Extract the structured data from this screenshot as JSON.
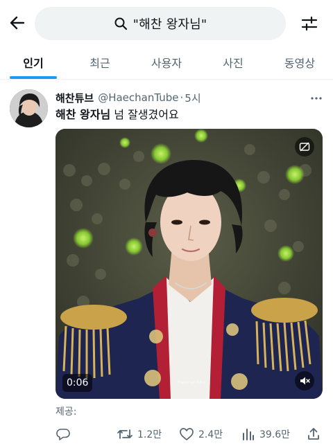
{
  "header": {
    "back_icon": "arrow-left-icon",
    "search_query": "\"해찬 왕자님\"",
    "search_icon": "search-icon",
    "filter_icon": "sliders-icon"
  },
  "tabs": [
    {
      "label": "인기",
      "active": true
    },
    {
      "label": "최근",
      "active": false
    },
    {
      "label": "사용자",
      "active": false
    },
    {
      "label": "사진",
      "active": false
    },
    {
      "label": "동영상",
      "active": false
    }
  ],
  "post": {
    "author_name": "해찬튜브",
    "handle": "@HaechanTube",
    "separator": "·",
    "time": "5시",
    "text_bold": "해찬 왕자님",
    "text_rest": " 넘 잘생겼어요",
    "media": {
      "duration": "0:06",
      "watermark": "HaechanTube",
      "top_badge_icon": "no-captions-icon",
      "mute_icon": "speaker-muted-icon"
    },
    "provided_label": "제공:",
    "stats": {
      "replies": "",
      "retweets": "1.2만",
      "likes": "2.4만",
      "views": "39.6만"
    }
  },
  "colors": {
    "accent": "#1d9bf0",
    "text_primary": "#0f1419",
    "text_secondary": "#536471",
    "search_bg": "#eff3f4"
  }
}
